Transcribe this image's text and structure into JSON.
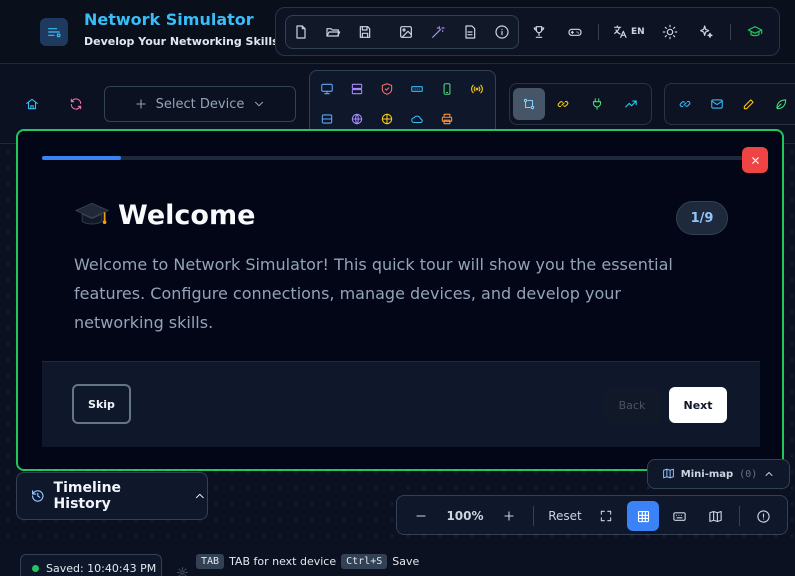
{
  "app": {
    "title": "Network Simulator",
    "subtitle": "Develop Your Networking Skills",
    "language": "EN"
  },
  "toolbar": {
    "select_device_label": "Select Device"
  },
  "tour": {
    "title": "Welcome",
    "step_badge": "1/9",
    "progress_fraction": 0.111,
    "body": "Welcome to Network Simulator! This quick tour will show you the essential features. Configure connections, manage devices, and develop your networking skills.",
    "skip_label": "Skip",
    "back_label": "Back",
    "next_label": "Next"
  },
  "minimap": {
    "label": "Mini-map",
    "count": "(0)"
  },
  "timeline": {
    "label": "Timeline History"
  },
  "zoom": {
    "level": "100%",
    "reset_label": "Reset"
  },
  "status": {
    "saved": "Saved: 10:40:43 PM",
    "tab_key": "TAB",
    "tab_hint": "TAB for next device",
    "save_key": "Ctrl+S",
    "save_hint": "Save"
  },
  "colors": {
    "accent": "#38bdf8",
    "primary": "#3b82f6",
    "highlight_border": "#22c55e",
    "danger": "#ef4444"
  }
}
